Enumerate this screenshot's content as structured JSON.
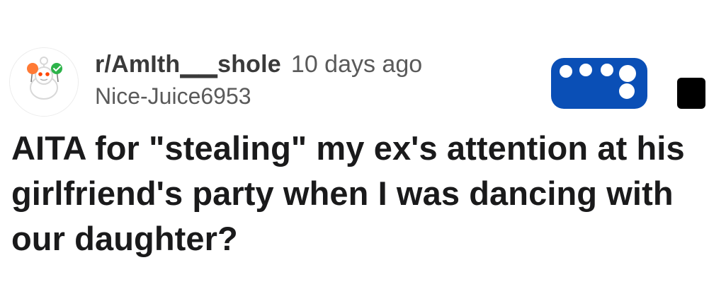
{
  "post": {
    "subreddit": "r/AmIth▁▁shole",
    "time_ago": "10 days ago",
    "author": "Nice-Juice6953",
    "title": "AITA for \"stealing\" my ex's attention at his girlfriend's party when I was dancing with our daughter?",
    "colors": {
      "join_button": "#0a4fb6",
      "title_text": "#1a1a1b",
      "meta_text": "#5a5a5a"
    },
    "icons": {
      "avatar": "snoo-avatar-icon",
      "overflow": "more-options-icon"
    }
  }
}
